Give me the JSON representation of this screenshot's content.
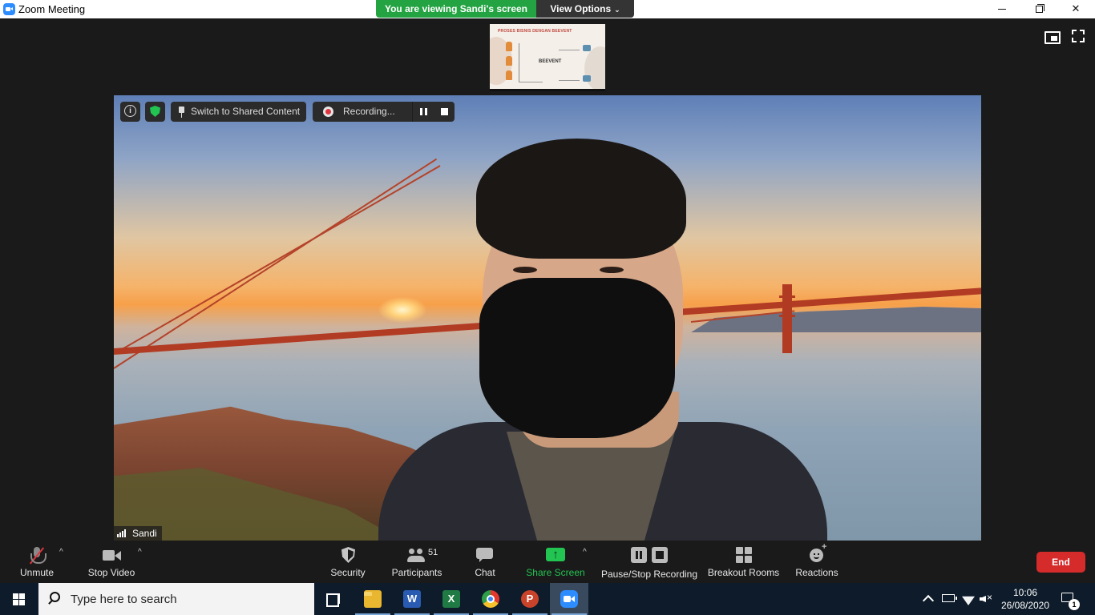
{
  "window": {
    "title": "Zoom Meeting",
    "controls": {
      "minimize_icon": "minimize-icon",
      "restore_icon": "restore-icon",
      "close_label": "✕"
    }
  },
  "banner": {
    "viewing_text": "You are viewing Sandi's screen",
    "options_label": "View Options",
    "options_caret": "⌄"
  },
  "shared_thumbnail": {
    "title": "PROSES BISNIS DENGAN BEEVENT",
    "center_label": "BEEVENT"
  },
  "video_overlay": {
    "switch_label": "Switch to Shared Content",
    "recording_label": "Recording..."
  },
  "participant": {
    "name": "Sandi"
  },
  "toolbar": {
    "unmute_label": "Unmute",
    "stop_video_label": "Stop Video",
    "security_label": "Security",
    "participants_label": "Participants",
    "participants_count": "51",
    "chat_label": "Chat",
    "share_screen_label": "Share Screen",
    "pause_stop_label": "Pause/Stop Recording",
    "breakout_label": "Breakout Rooms",
    "reactions_label": "Reactions",
    "end_label": "End",
    "caret": "^"
  },
  "taskbar": {
    "search_placeholder": "Type here to search",
    "apps": {
      "word_glyph": "W",
      "excel_glyph": "X",
      "ppt_glyph": "P"
    },
    "clock_time": "10:06",
    "clock_date": "26/08/2020",
    "notification_count": "1"
  },
  "colors": {
    "share_green": "#23c552",
    "viewing_green": "#23a342",
    "end_red": "#d52b2b",
    "recording_red": "#e0353d",
    "zoom_blue": "#2d8cff"
  }
}
